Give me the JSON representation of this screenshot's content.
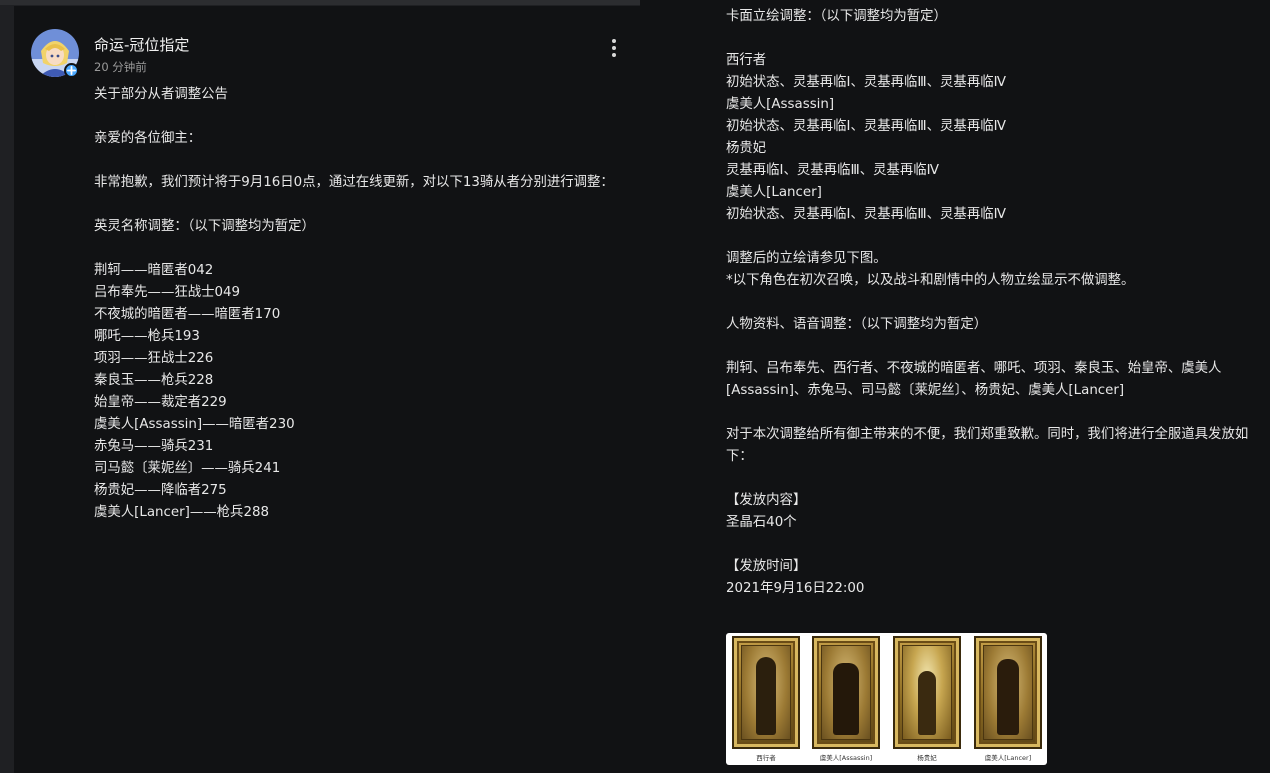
{
  "post": {
    "author": "命运-冠位指定",
    "time": "20 分钟前",
    "left_lines": [
      "关于部分从者调整公告",
      "",
      "亲爱的各位御主：",
      "",
      "非常抱歉，我们预计将于9月16日0点，通过在线更新，对以下13骑从者分别进行调整：",
      "",
      "英灵名称调整：（以下调整均为暂定）",
      "",
      "荆轲——暗匿者042",
      "吕布奉先——狂战士049",
      "不夜城的暗匿者——暗匿者170",
      "哪吒——枪兵193",
      "项羽——狂战士226",
      "秦良玉——枪兵228",
      "始皇帝——裁定者229",
      "虞美人[Assassin]——暗匿者230",
      "赤兔马——骑兵231",
      "司马懿〔莱妮丝〕——骑兵241",
      "杨贵妃——降临者275",
      "虞美人[Lancer]——枪兵288"
    ],
    "right_lines": [
      "卡面立绘调整：（以下调整均为暂定）",
      "",
      "西行者",
      "初始状态、灵基再临Ⅰ、灵基再临Ⅲ、灵基再临Ⅳ",
      "虞美人[Assassin]",
      "初始状态、灵基再临Ⅰ、灵基再临Ⅲ、灵基再临Ⅳ",
      "杨贵妃",
      "灵基再临Ⅰ、灵基再临Ⅲ、灵基再临Ⅳ",
      "虞美人[Lancer]",
      "初始状态、灵基再临Ⅰ、灵基再临Ⅲ、灵基再临Ⅳ",
      "",
      "调整后的立绘请参见下图。",
      "*以下角色在初次召唤，以及战斗和剧情中的人物立绘显示不做调整。",
      "",
      "人物资料、语音调整：（以下调整均为暂定）",
      "",
      "荆轲、吕布奉先、西行者、不夜城的暗匿者、哪吒、项羽、秦良玉、始皇帝、虞美人[Assassin]、赤兔马、司马懿〔莱妮丝〕、杨贵妃、虞美人[Lancer]",
      "",
      "对于本次调整给所有御主带来的不便，我们郑重致歉。同时，我们将进行全服道具发放如下：",
      "",
      "【发放内容】",
      "圣晶石40个",
      "",
      "【发放时间】",
      "2021年9月16日22:00"
    ]
  },
  "image": {
    "cards": [
      {
        "caption": "西行者"
      },
      {
        "caption": "虞美人[Assassin]"
      },
      {
        "caption": "杨贵妃"
      },
      {
        "caption": "虞美人[Lancer]"
      }
    ]
  },
  "icons": {
    "more": "more-vertical-icon",
    "verified": "verified-badge-icon"
  },
  "colors": {
    "background": "#111214",
    "text": "#e8e8e8",
    "muted": "#9a9a9a",
    "verified": "#4aa8ff"
  }
}
